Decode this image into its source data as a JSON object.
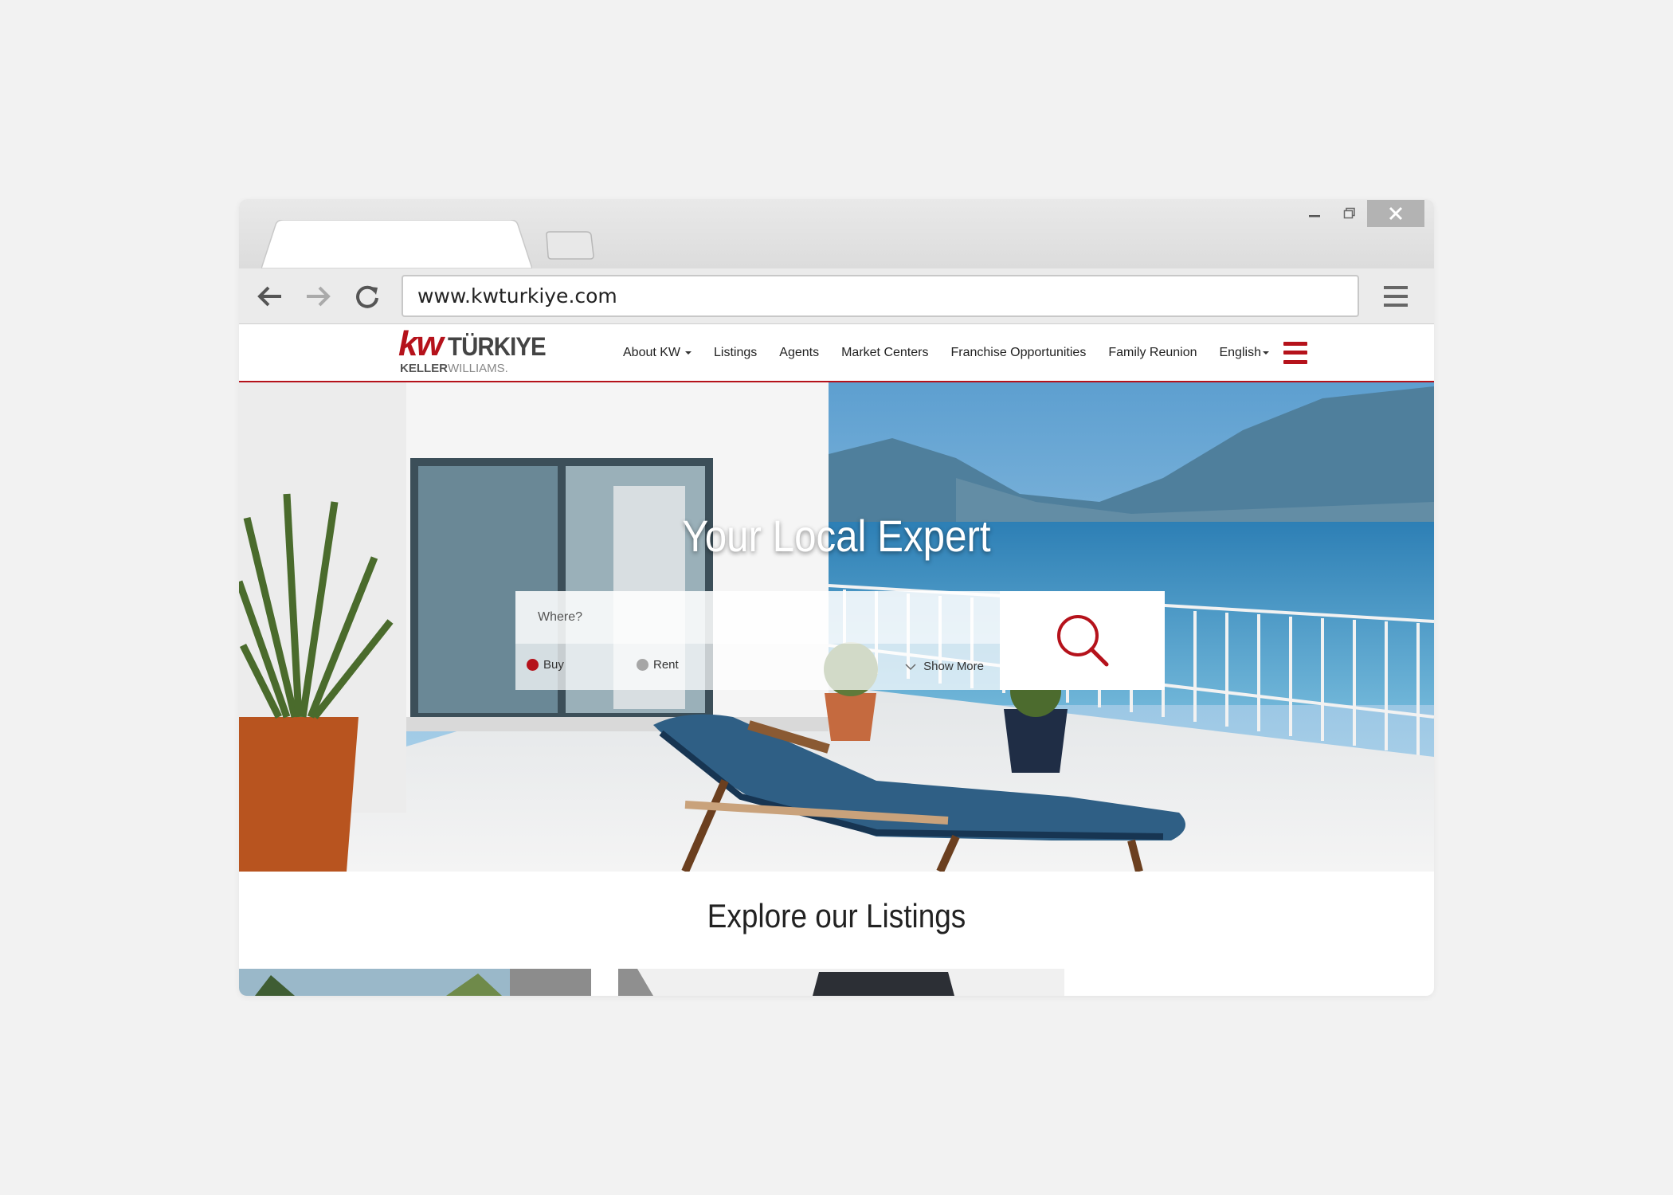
{
  "browser": {
    "url": "www.kwturkiye.com"
  },
  "site": {
    "logo": {
      "kw": "kw",
      "brand": "TÜRKIYE",
      "sub_bold": "KELLER",
      "sub_light": "WILLIAMS."
    },
    "nav": [
      {
        "label": "About KW",
        "dropdown": true
      },
      {
        "label": "Listings",
        "dropdown": false
      },
      {
        "label": "Agents",
        "dropdown": false
      },
      {
        "label": "Market Centers",
        "dropdown": false
      },
      {
        "label": "Franchise Opportunities",
        "dropdown": false
      },
      {
        "label": "Family Reunion",
        "dropdown": false
      },
      {
        "label": "English",
        "dropdown": true
      }
    ],
    "accent_color": "#b5121b"
  },
  "hero": {
    "title": "Your Local Expert",
    "search": {
      "placeholder": "Where?",
      "options": [
        {
          "label": "Buy",
          "selected": true
        },
        {
          "label": "Rent",
          "selected": false
        }
      ],
      "show_more": "Show More"
    }
  },
  "explore": {
    "title": "Explore our Listings"
  }
}
